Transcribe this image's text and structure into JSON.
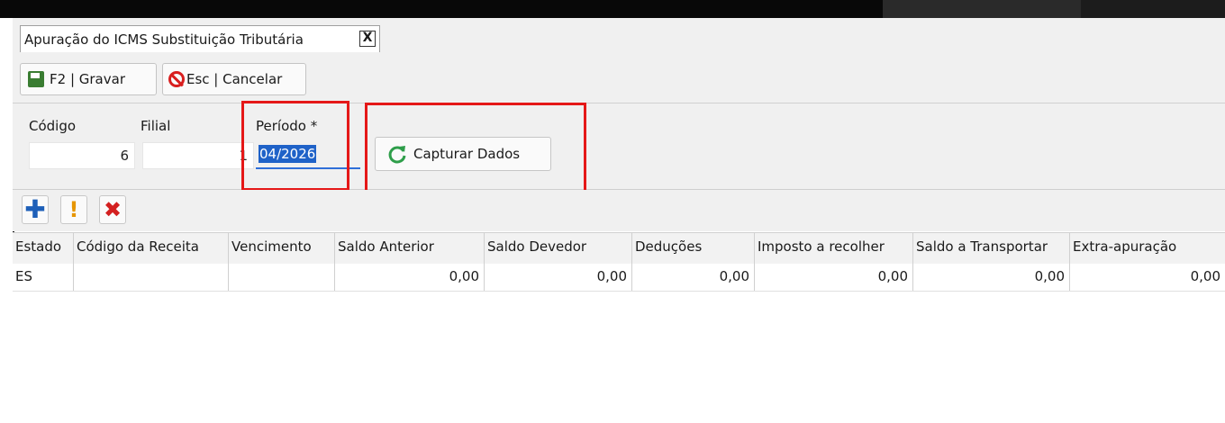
{
  "tab": {
    "title": "Apuração do ICMS Substituição Tributária",
    "close_label": "X"
  },
  "toolbar": {
    "save_label": "F2 | Gravar",
    "cancel_label": "Esc | Cancelar"
  },
  "form": {
    "codigo_label": "Código",
    "codigo_value": "6",
    "filial_label": "Filial",
    "filial_value": "1",
    "periodo_label": "Período *",
    "periodo_value": "04/2026",
    "capture_label": "Capturar Dados"
  },
  "grid_toolbar": {
    "add_icon": "plus-icon",
    "warn_icon": "exclamation-icon",
    "delete_icon": "x-icon"
  },
  "grid": {
    "columns": [
      "Estado",
      "Código da Receita",
      "Vencimento",
      "Saldo Anterior",
      "Saldo Devedor",
      "Deduções",
      "Imposto a recolher",
      "Saldo a Transportar",
      "Extra-apuração"
    ],
    "rows": [
      [
        "ES",
        "",
        "",
        "0,00",
        "0,00",
        "0,00",
        "0,00",
        "0,00",
        "0,00"
      ]
    ]
  },
  "colors": {
    "highlight_box": "#e51818",
    "selection": "#1f62c8"
  }
}
